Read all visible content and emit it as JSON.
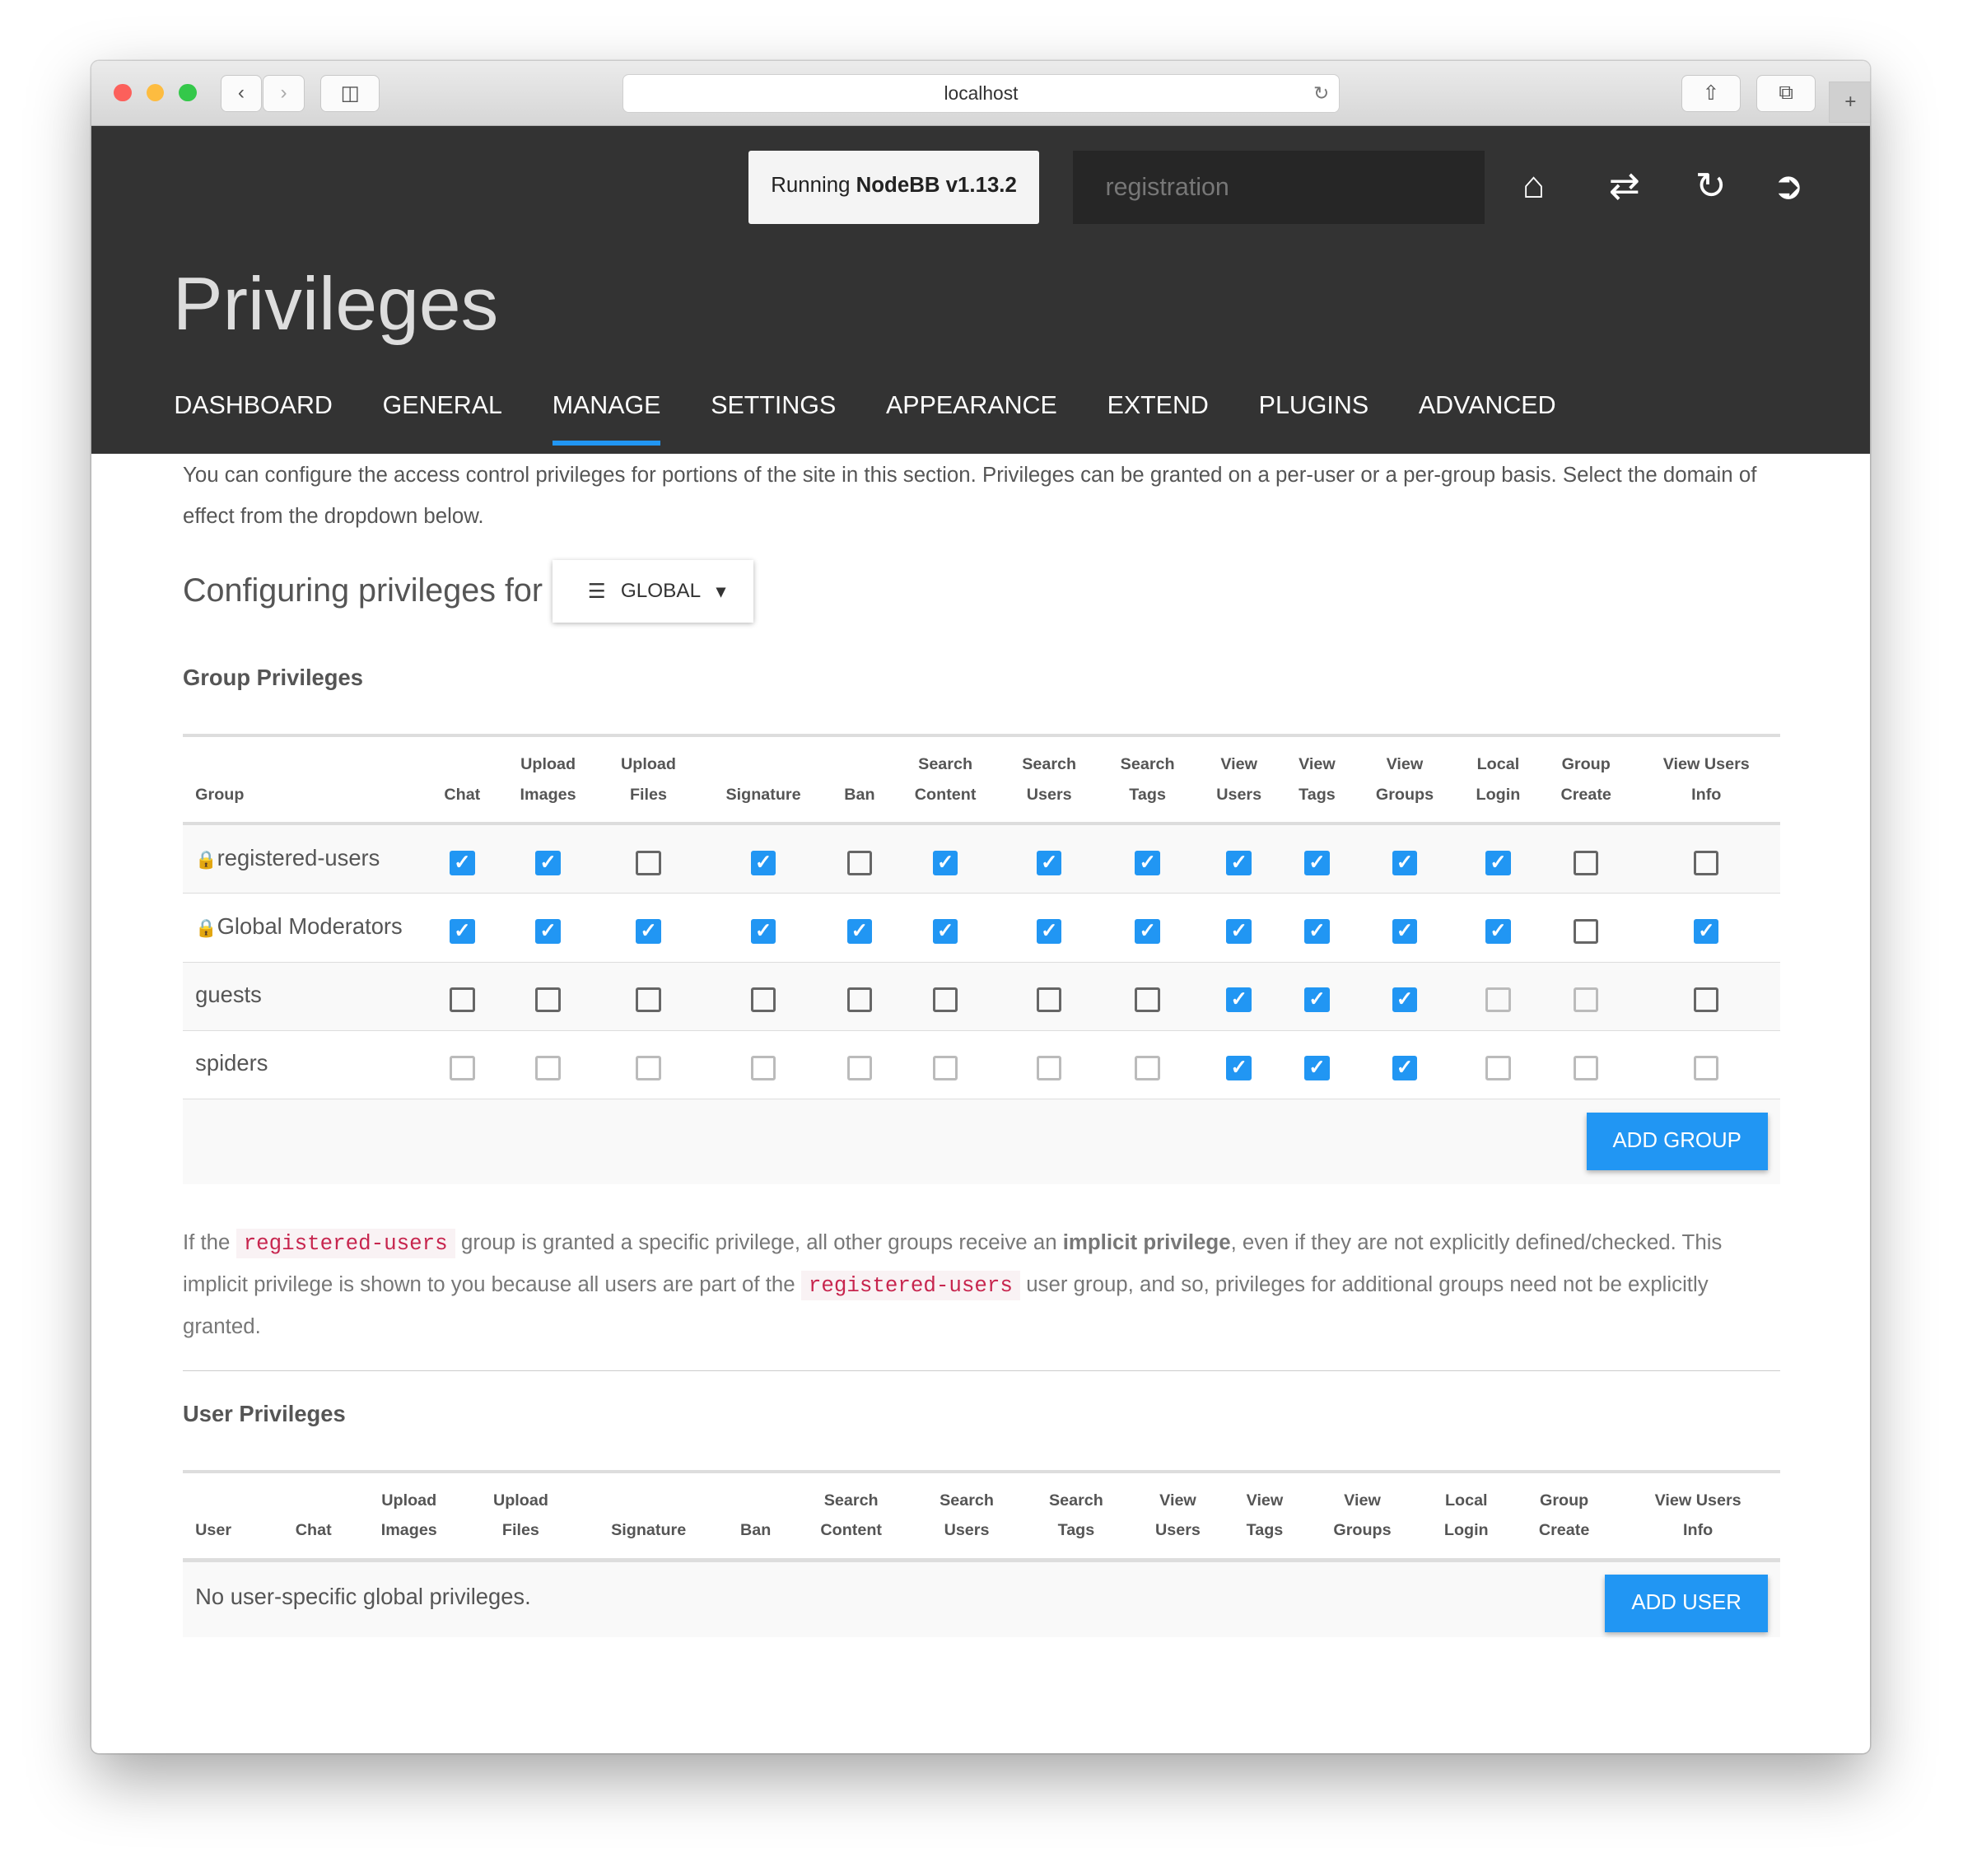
{
  "browser": {
    "url": "localhost"
  },
  "header": {
    "version_prefix": "Running ",
    "version_name": "NodeBB v1.13.2",
    "search_placeholder": "registration",
    "page_title": "Privileges"
  },
  "nav": [
    "DASHBOARD",
    "GENERAL",
    "MANAGE",
    "SETTINGS",
    "APPEARANCE",
    "EXTEND",
    "PLUGINS",
    "ADVANCED"
  ],
  "nav_active": "MANAGE",
  "accent": "#2196f3",
  "intro": "You can configure the access control privileges for portions of the site in this section. Privileges can be granted on a per-user or a per-group basis. Select the domain of effect from the dropdown below.",
  "configuring_label": "Configuring privileges for",
  "dropdown_value": "GLOBAL",
  "group_section": {
    "title": "Group Privileges",
    "first_col": "Group",
    "columns": [
      [
        "",
        "Chat"
      ],
      [
        "Upload",
        "Images"
      ],
      [
        "Upload",
        "Files"
      ],
      [
        "",
        "Signature"
      ],
      [
        "",
        "Ban"
      ],
      [
        "Search",
        "Content"
      ],
      [
        "Search",
        "Users"
      ],
      [
        "Search",
        "Tags"
      ],
      [
        "View",
        "Users"
      ],
      [
        "View",
        "Tags"
      ],
      [
        "View",
        "Groups"
      ],
      [
        "Local",
        "Login"
      ],
      [
        "Group",
        "Create"
      ],
      [
        "View Users",
        "Info"
      ]
    ],
    "rows": [
      {
        "name": "registered-users",
        "locked": true,
        "states": "ccucucccccccuu"
      },
      {
        "name": "Global Moderators",
        "locked": true,
        "states": "ccccccccccccuc"
      },
      {
        "name": "guests",
        "locked": false,
        "states": "uuuuuuuucccddu"
      },
      {
        "name": "spiders",
        "locked": false,
        "states": "ddddddddcccddd"
      }
    ],
    "add_button": "ADD GROUP"
  },
  "note": {
    "p1": "If the ",
    "code": "registered-users",
    "p2": " group is granted a specific privilege, all other groups receive an ",
    "bold": "implicit privilege",
    "p3": ", even if they are not explicitly defined/checked. This implicit privilege is shown to you because all users are part of the ",
    "p4": " user group, and so, privileges for additional groups need not be explicitly granted."
  },
  "user_section": {
    "title": "User Privileges",
    "first_col": "User",
    "empty": "No user-specific global privileges.",
    "add_button": "ADD USER"
  }
}
